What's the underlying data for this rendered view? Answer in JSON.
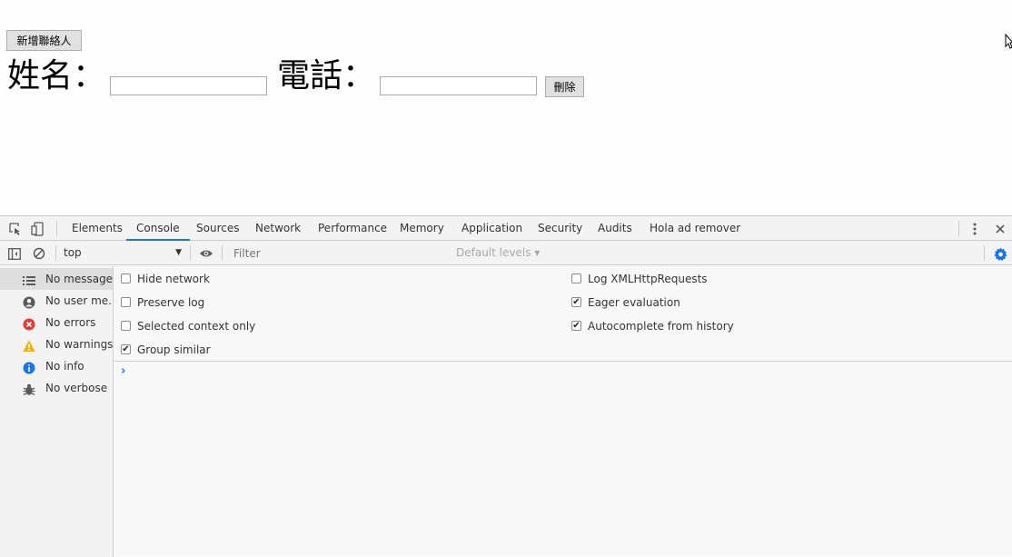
{
  "page": {
    "add_button": "新增聯絡人",
    "name_label": "姓名：",
    "phone_label": "電話：",
    "name_value": "",
    "phone_value": "",
    "delete_button": "刪除"
  },
  "devtools": {
    "tabs": [
      {
        "label": "Elements"
      },
      {
        "label": "Console"
      },
      {
        "label": "Sources"
      },
      {
        "label": "Network"
      },
      {
        "label": "Performance"
      },
      {
        "label": "Memory"
      },
      {
        "label": "Application"
      },
      {
        "label": "Security"
      },
      {
        "label": "Audits"
      },
      {
        "label": "Hola ad remover"
      }
    ],
    "active_tab": "Console",
    "toolbar": {
      "context": "top",
      "filter_placeholder": "Filter",
      "levels": "Default levels ▾"
    },
    "sidebar": [
      {
        "label": "No messages",
        "icon": "list-icon"
      },
      {
        "label": "No user me...",
        "icon": "user-icon"
      },
      {
        "label": "No errors",
        "icon": "error-icon"
      },
      {
        "label": "No warnings",
        "icon": "warning-icon"
      },
      {
        "label": "No info",
        "icon": "info-icon"
      },
      {
        "label": "No verbose",
        "icon": "bug-icon"
      }
    ],
    "settings_left": [
      {
        "label": "Hide network",
        "checked": false
      },
      {
        "label": "Preserve log",
        "checked": false
      },
      {
        "label": "Selected context only",
        "checked": false
      },
      {
        "label": "Group similar",
        "checked": true
      }
    ],
    "settings_right": [
      {
        "label": "Log XMLHttpRequests",
        "checked": false
      },
      {
        "label": "Eager evaluation",
        "checked": true
      },
      {
        "label": "Autocomplete from history",
        "checked": true
      }
    ],
    "prompt": "›",
    "colors": {
      "accent": "#1a73e8",
      "error": "#e53935",
      "warning": "#f4b400",
      "info": "#1a73e8"
    }
  }
}
